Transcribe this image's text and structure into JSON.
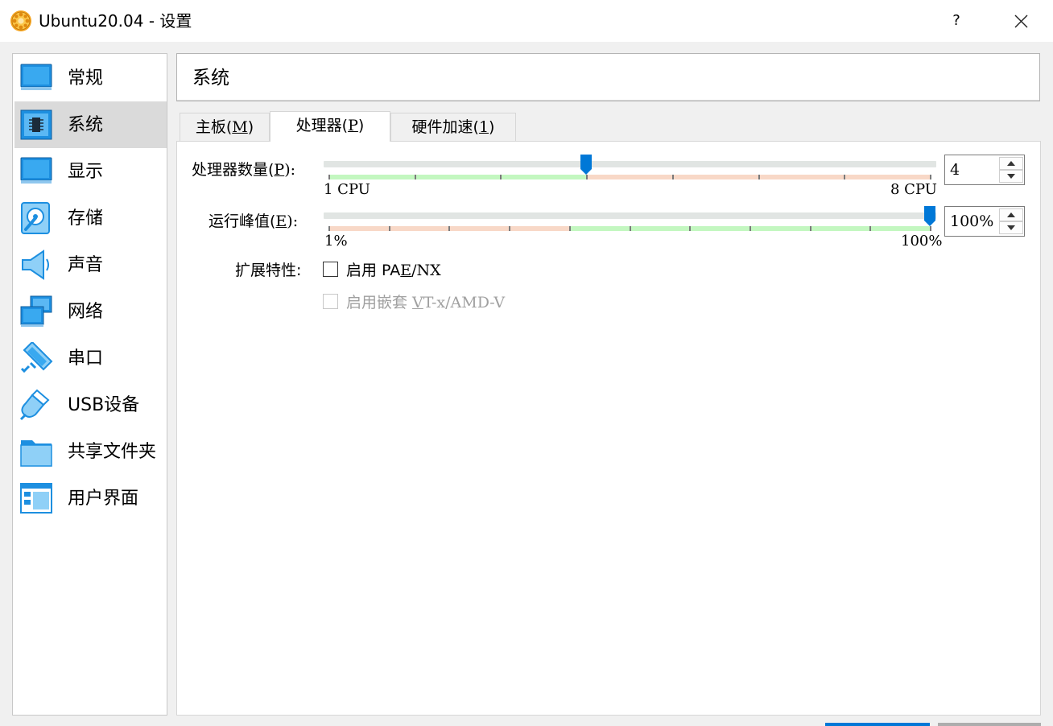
{
  "window": {
    "title": "Ubuntu20.04 - 设置",
    "help_label": "?"
  },
  "nav": {
    "items": [
      {
        "label": "常规",
        "icon": "general-icon"
      },
      {
        "label": "系统",
        "icon": "system-icon",
        "selected": true
      },
      {
        "label": "显示",
        "icon": "display-icon"
      },
      {
        "label": "存储",
        "icon": "storage-icon"
      },
      {
        "label": "声音",
        "icon": "audio-icon"
      },
      {
        "label": "网络",
        "icon": "network-icon"
      },
      {
        "label": "串口",
        "icon": "serial-port-icon"
      },
      {
        "label": "USB设备",
        "icon": "usb-icon"
      },
      {
        "label": "共享文件夹",
        "icon": "shared-folder-icon"
      },
      {
        "label": "用户界面",
        "icon": "user-interface-icon"
      }
    ]
  },
  "header": {
    "title": "系统"
  },
  "tabs": [
    {
      "text": "主板(",
      "key": "M",
      "end": ")"
    },
    {
      "text": "处理器(",
      "key": "P",
      "end": ")",
      "active": true
    },
    {
      "text": "硬件加速(",
      "key": "1",
      "end": ")"
    }
  ],
  "processor": {
    "cpu_count": {
      "label_text": "处理器数量(",
      "label_key": "P",
      "label_end": "):",
      "min_label": "1 CPU",
      "max_label": "8 CPU",
      "value": "4",
      "min": 1,
      "max": 8,
      "current": 4
    },
    "execution_cap": {
      "label_text": "运行峰值(",
      "label_key": "E",
      "label_end": "):",
      "min_label": "1%",
      "max_label": "100%",
      "value": "100%",
      "min": 1,
      "max": 100,
      "current": 100
    },
    "extended_features": {
      "label": "扩展特性:",
      "pae": {
        "text": "启用 PA",
        "key": "E",
        "end": "/NX",
        "checked": false
      },
      "nested_vtx": {
        "text": "启用嵌套 ",
        "key": "V",
        "end": "T-x/AMD-V",
        "checked": false,
        "disabled": true
      }
    }
  },
  "colors": {
    "accent": "#0078d7",
    "slider_good": "#c3f7c0",
    "slider_bad": "#f8d8c7"
  }
}
